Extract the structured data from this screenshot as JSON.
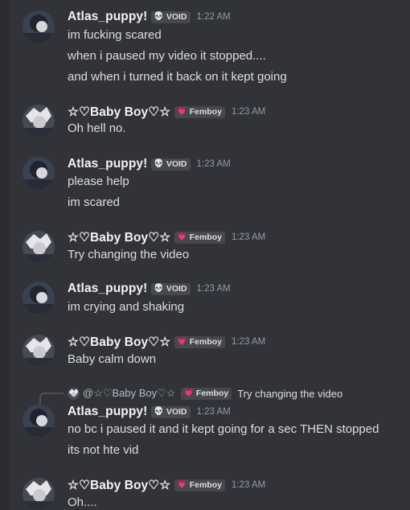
{
  "users": {
    "atlas": {
      "name": "Atlas_puppy!",
      "tag_icon": "💀",
      "tag": "VOID"
    },
    "baby": {
      "name": "☆♡Baby Boy♡☆",
      "tag_icon": "💗",
      "tag": "Femboy"
    }
  },
  "messages": [
    {
      "user": "atlas",
      "time": "1:22 AM",
      "lines": [
        "im fucking scared",
        "when i paused my video it stopped....",
        "and when i turned it back on it kept going"
      ]
    },
    {
      "user": "baby",
      "time": "1:23 AM",
      "lines": [
        "Oh hell no."
      ]
    },
    {
      "user": "atlas",
      "time": "1:23 AM",
      "lines": [
        "please help",
        "im scared"
      ]
    },
    {
      "user": "baby",
      "time": "1:23 AM",
      "lines": [
        "Try changing the video"
      ]
    },
    {
      "user": "atlas",
      "time": "1:23 AM",
      "lines": [
        "im crying and shaking"
      ]
    },
    {
      "user": "baby",
      "time": "1:23 AM",
      "lines": [
        "Baby calm down"
      ]
    },
    {
      "user": "atlas",
      "time": "1:23 AM",
      "lines": [
        "no bc i paused it and it kept going for a sec THEN stopped",
        "its not hte vid"
      ]
    },
    {
      "user": "baby",
      "time": "1:23 AM",
      "lines": [
        "Oh...."
      ]
    }
  ],
  "reply": {
    "mention": "@☆♡Baby Boy♡☆",
    "tag_icon": "💗",
    "tag": "Femboy",
    "text": "Try changing the video"
  },
  "colors": {
    "background": "#323339",
    "username": "#f2f3f5",
    "text": "#dbdee1",
    "timestamp": "#949ba4",
    "tag_bg": "#47484e",
    "heart": "#f47fb3"
  }
}
